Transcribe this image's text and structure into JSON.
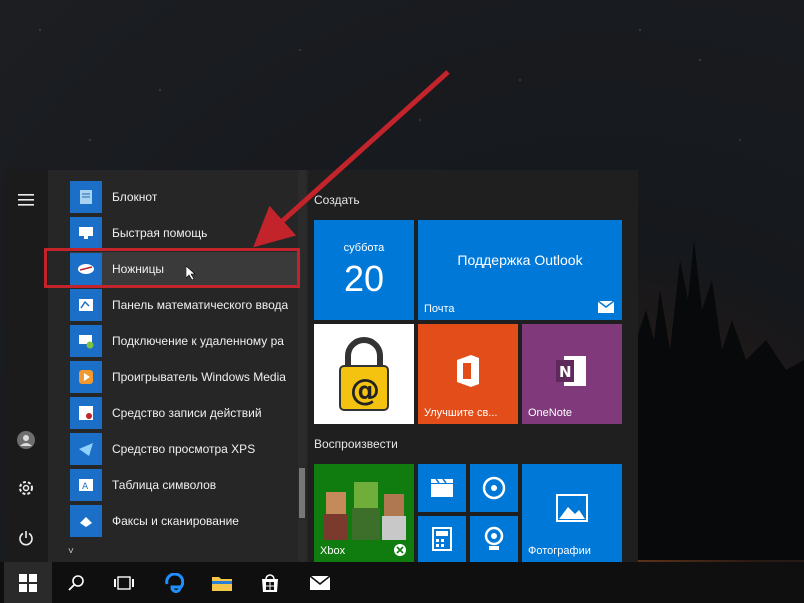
{
  "rail": {
    "icons": [
      "hamburger-icon",
      "user-icon",
      "gear-icon",
      "power-icon"
    ]
  },
  "applist": {
    "items": [
      {
        "label": "Блокнот",
        "icon": "notepad-icon"
      },
      {
        "label": "Быстрая помощь",
        "icon": "quick-assist-icon"
      },
      {
        "label": "Ножницы",
        "icon": "snipping-tool-icon"
      },
      {
        "label": "Панель математического ввода",
        "icon": "math-input-icon"
      },
      {
        "label": "Подключение к удаленному ра",
        "icon": "remote-desktop-icon"
      },
      {
        "label": "Проигрыватель Windows Media",
        "icon": "media-player-icon"
      },
      {
        "label": "Средство записи действий",
        "icon": "steps-recorder-icon"
      },
      {
        "label": "Средство просмотра XPS",
        "icon": "xps-viewer-icon"
      },
      {
        "label": "Таблица символов",
        "icon": "character-map-icon"
      },
      {
        "label": "Факсы и сканирование",
        "icon": "fax-scan-icon"
      }
    ],
    "highlighted": "Ножницы",
    "collapse_glyph": "˅"
  },
  "tiles": {
    "group_create": "Создать",
    "group_play": "Воспроизвести",
    "calendar": {
      "day": "суббота",
      "date": "20"
    },
    "outlook": {
      "title": "Поддержка Outlook",
      "label": "Почта"
    },
    "office": {
      "label": "Улучшите св..."
    },
    "onenote": {
      "label": "OneNote"
    },
    "xbox": {
      "label": "Xbox"
    },
    "photos": {
      "label": "Фотографии"
    }
  },
  "taskbar": {
    "icons": [
      "windows-start-icon",
      "search-icon",
      "task-view-icon",
      "edge-icon",
      "file-explorer-icon",
      "store-icon",
      "mail-icon"
    ]
  },
  "colors": {
    "tile_blue": "#0078d7",
    "office_orange": "#e34d1a",
    "onenote_purple": "#80397b",
    "xbox_green": "#107c10",
    "highlight_red": "#c3232b"
  }
}
